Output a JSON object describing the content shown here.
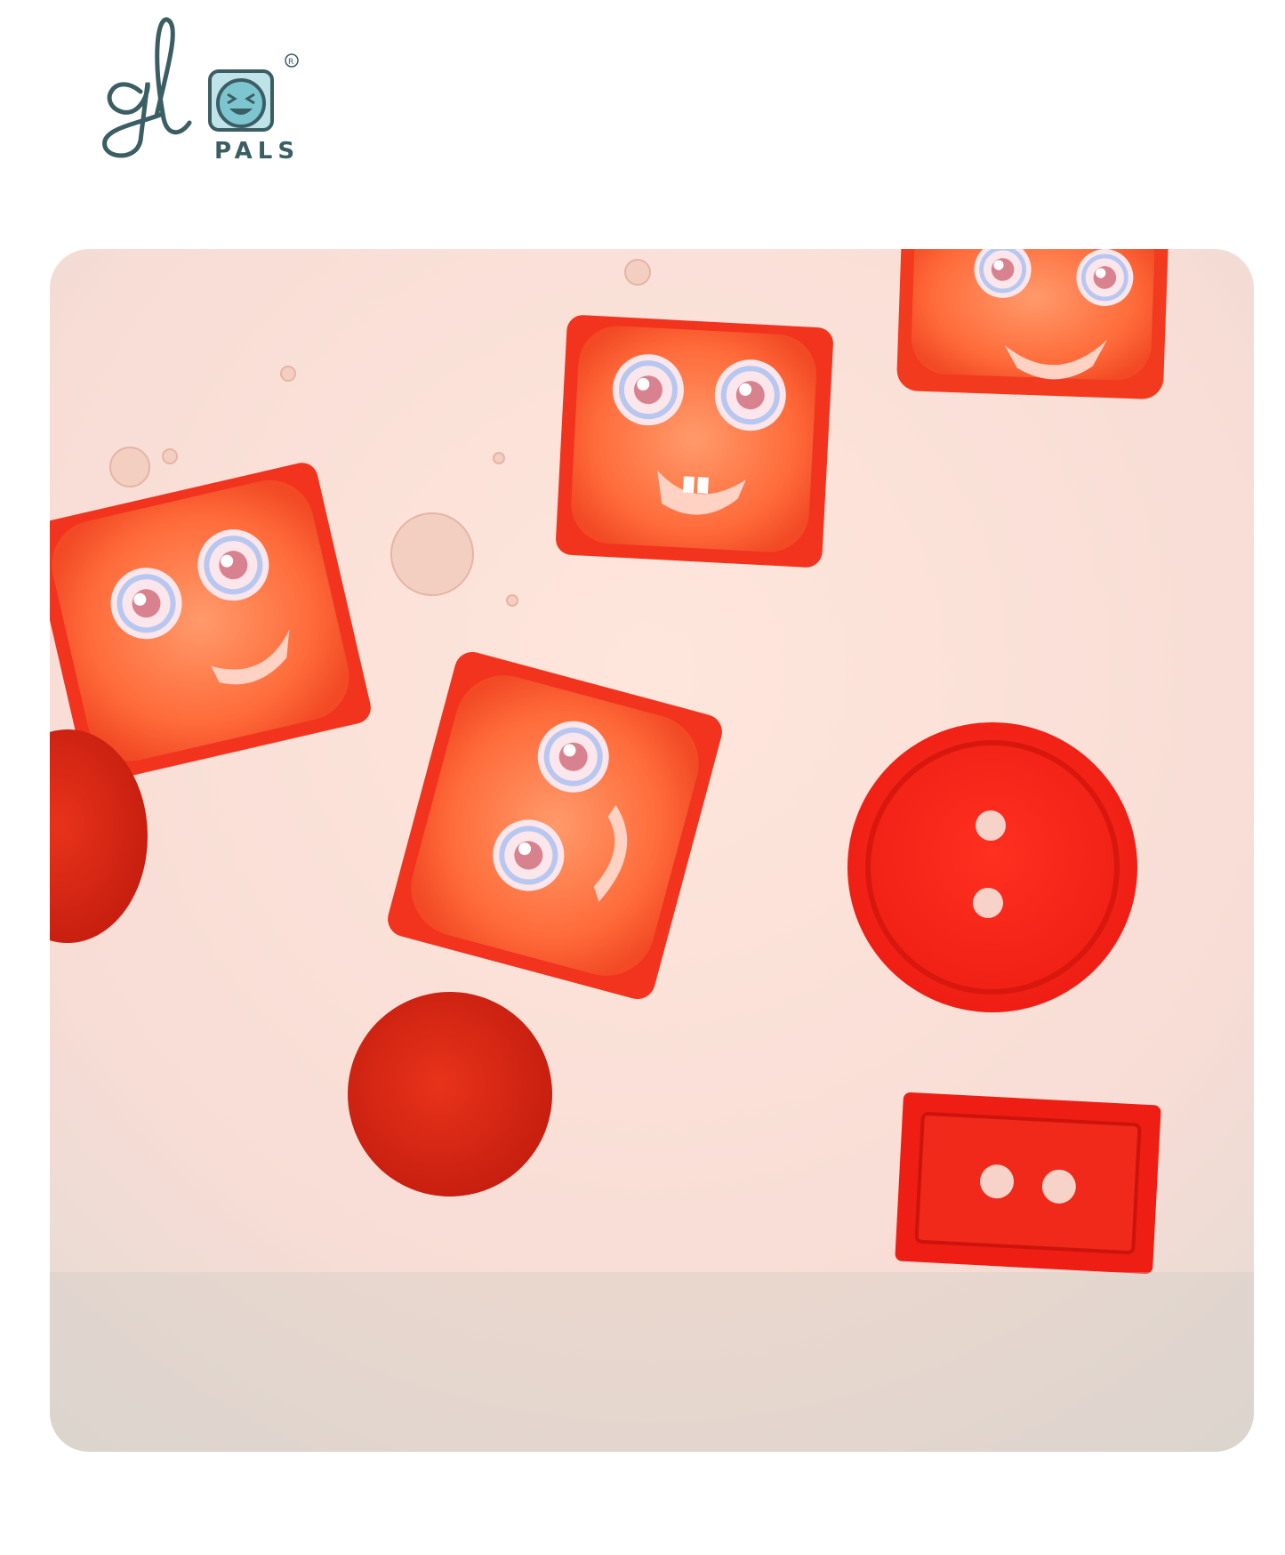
{
  "brand": {
    "wordmark": "glo",
    "sub_label": "PALS",
    "registered_mark": "®"
  },
  "photo": {
    "subject_icons": [
      "cube-character-icon",
      "pom-pom-icon",
      "round-button-icon",
      "rectangular-button-icon"
    ]
  },
  "colors": {
    "logo": "#3a5e63",
    "logo_accent": "#7ec6cf",
    "cube_red": "#f2331e",
    "cube_orange": "#ff7a3d",
    "background": "#fbe6df"
  }
}
